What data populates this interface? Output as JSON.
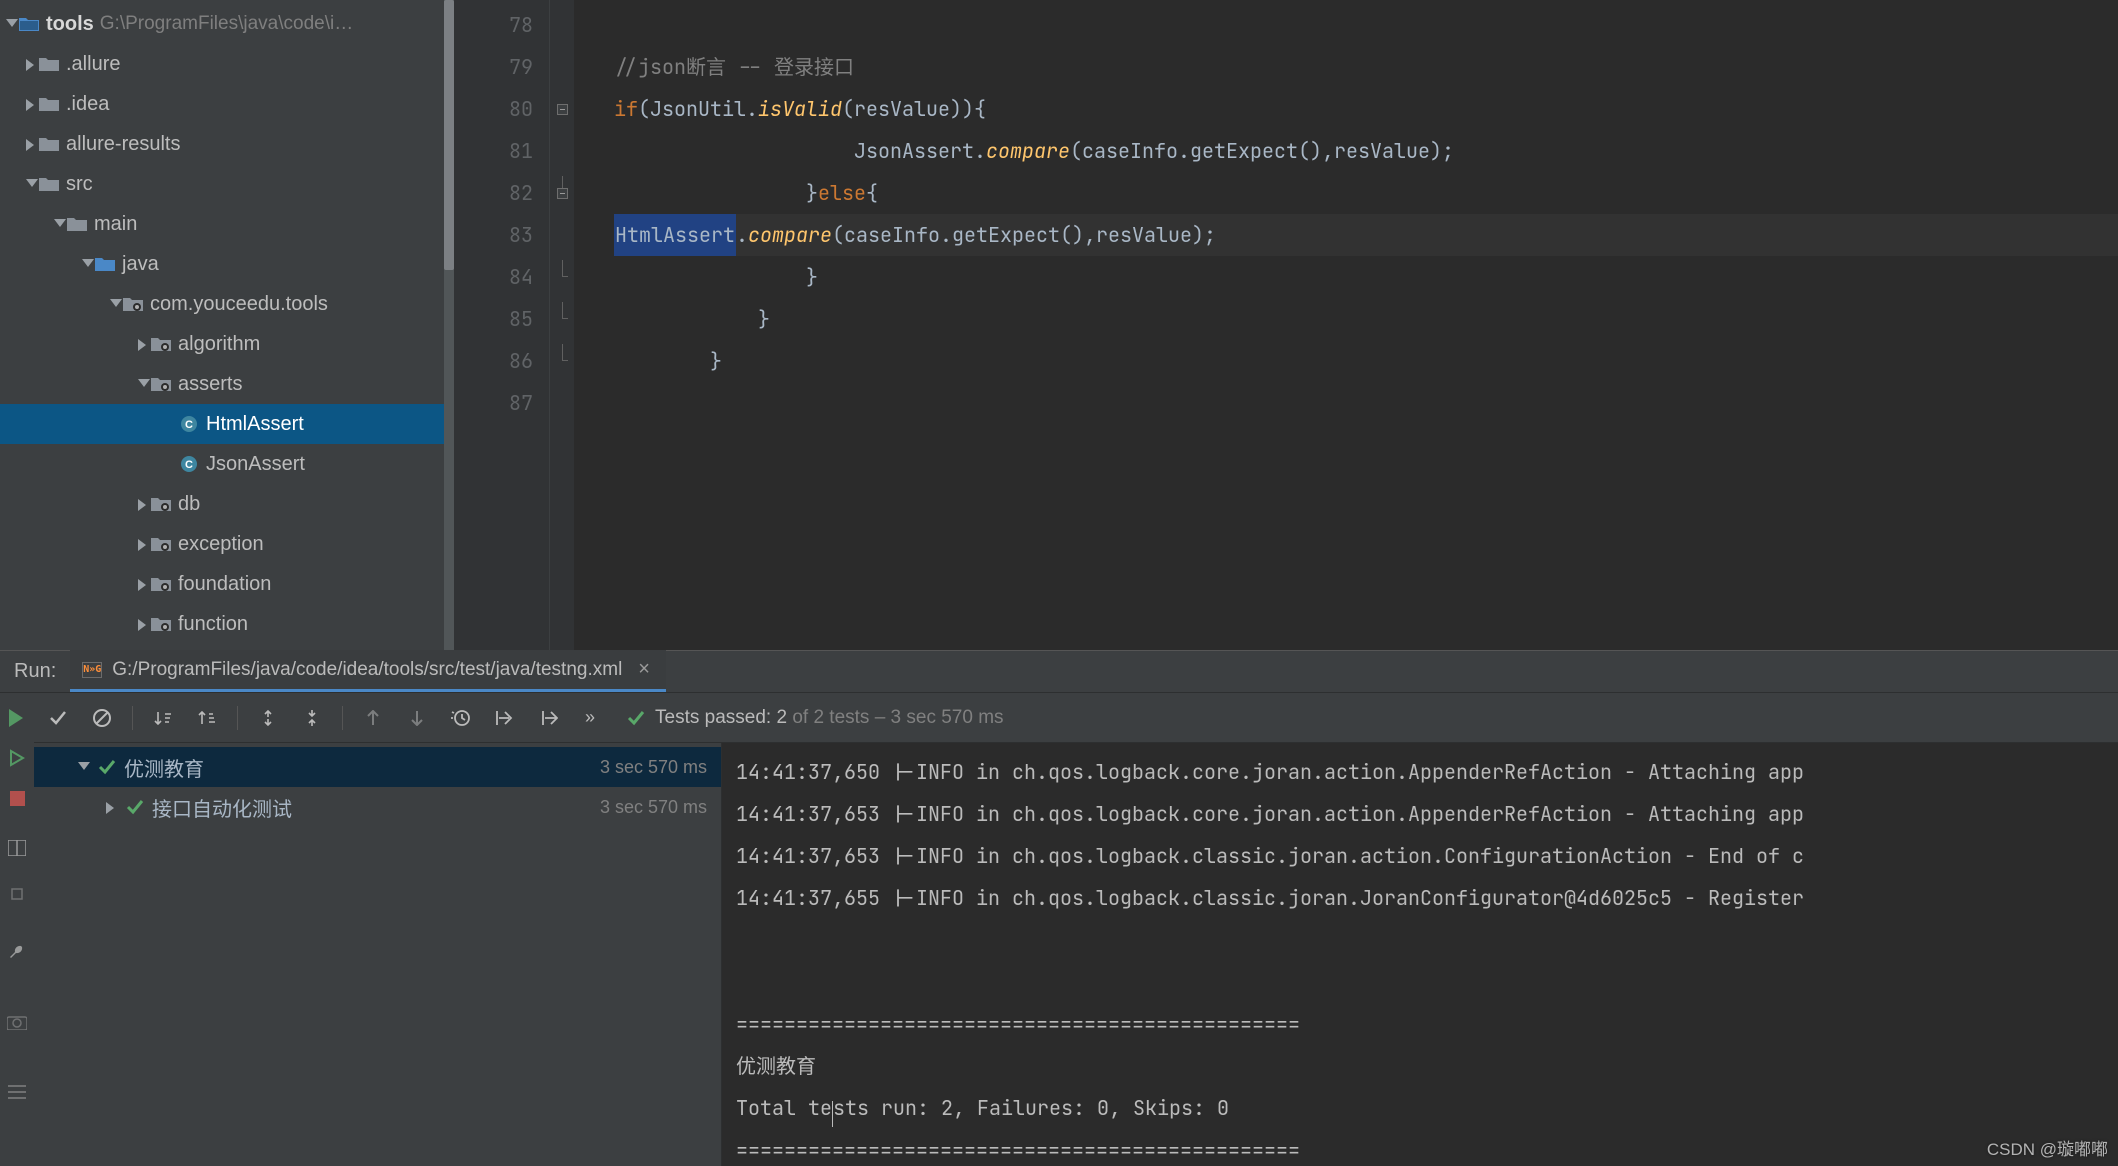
{
  "project": {
    "root_label": "tools",
    "root_path": "G:\\ProgramFiles\\java\\code\\i…",
    "nodes": [
      {
        "indent": 24,
        "twist": "closed",
        "icon": "folder",
        "label": ".allure"
      },
      {
        "indent": 24,
        "twist": "closed",
        "icon": "folder",
        "label": ".idea"
      },
      {
        "indent": 24,
        "twist": "closed",
        "icon": "folder",
        "label": "allure-results"
      },
      {
        "indent": 24,
        "twist": "open",
        "icon": "folder",
        "label": "src"
      },
      {
        "indent": 52,
        "twist": "open",
        "icon": "folder",
        "label": "main"
      },
      {
        "indent": 80,
        "twist": "open",
        "icon": "folder-src",
        "label": "java"
      },
      {
        "indent": 108,
        "twist": "open",
        "icon": "package",
        "label": "com.youceedu.tools"
      },
      {
        "indent": 136,
        "twist": "closed",
        "icon": "package",
        "label": "algorithm"
      },
      {
        "indent": 136,
        "twist": "open",
        "icon": "package",
        "label": "asserts"
      },
      {
        "indent": 164,
        "twist": "none",
        "icon": "class",
        "label": "HtmlAssert",
        "selected": true
      },
      {
        "indent": 164,
        "twist": "none",
        "icon": "class",
        "label": "JsonAssert"
      },
      {
        "indent": 136,
        "twist": "closed",
        "icon": "package",
        "label": "db"
      },
      {
        "indent": 136,
        "twist": "closed",
        "icon": "package",
        "label": "exception"
      },
      {
        "indent": 136,
        "twist": "closed",
        "icon": "package",
        "label": "foundation"
      },
      {
        "indent": 136,
        "twist": "closed",
        "icon": "package",
        "label": "function"
      }
    ]
  },
  "editor": {
    "first_line": 78,
    "lines": [
      {
        "n": 78,
        "fold": "",
        "html": ""
      },
      {
        "n": 79,
        "fold": "",
        "html": "                <span class='tok-cmt'>//json断言 -- 登录接口</span>"
      },
      {
        "n": 80,
        "fold": "minus",
        "html": "                <span class='tok-kw'>if</span>(JsonUtil.<span class='tok-static'>isValid</span>(resValue)){"
      },
      {
        "n": 81,
        "fold": "",
        "html": "                    JsonAssert.<span class='tok-static'>compare</span>(caseInfo.getExpect(),resValue);"
      },
      {
        "n": 82,
        "fold": "end-minus",
        "html": "                }<span class='tok-kw'>else</span>{",
        "current": false
      },
      {
        "n": 83,
        "fold": "",
        "html": "                    <span class='sel'>HtmlAssert</span>.<span class='tok-static'>compare</span>(caseInfo.getExpect(),resValue);",
        "current": true
      },
      {
        "n": 84,
        "fold": "end",
        "html": "                }"
      },
      {
        "n": 85,
        "fold": "end",
        "html": "            }"
      },
      {
        "n": 86,
        "fold": "end",
        "html": "        }"
      },
      {
        "n": 87,
        "fold": "",
        "html": ""
      }
    ]
  },
  "run": {
    "title": "Run:",
    "tab_path": "G:/ProgramFiles/java/code/idea/tools/src/test/java/testng.xml",
    "status_label": "Tests passed:",
    "status_passed": "2",
    "status_rest": "of 2 tests – 3 sec 570 ms",
    "tests": [
      {
        "indent": 34,
        "twist": "open",
        "pass": true,
        "label": "优测教育",
        "time": "3 sec 570 ms",
        "sel": true
      },
      {
        "indent": 62,
        "twist": "closed",
        "pass": true,
        "label": "接口自动化测试",
        "time": "3 sec 570 ms"
      }
    ],
    "console": [
      "14:41:37,650 |-INFO in ch.qos.logback.core.joran.action.AppenderRefAction - Attaching app",
      "14:41:37,653 |-INFO in ch.qos.logback.core.joran.action.AppenderRefAction - Attaching app",
      "14:41:37,653 |-INFO in ch.qos.logback.classic.joran.action.ConfigurationAction - End of c",
      "14:41:37,655 |-INFO in ch.qos.logback.classic.joran.JoranConfigurator@4d6025c5 - Register",
      "",
      "",
      "===============================================",
      "优测教育",
      "Total tests run: 2, Failures: 0, Skips: 0",
      "==============================================="
    ]
  },
  "watermark": "CSDN @璇嘟嘟"
}
